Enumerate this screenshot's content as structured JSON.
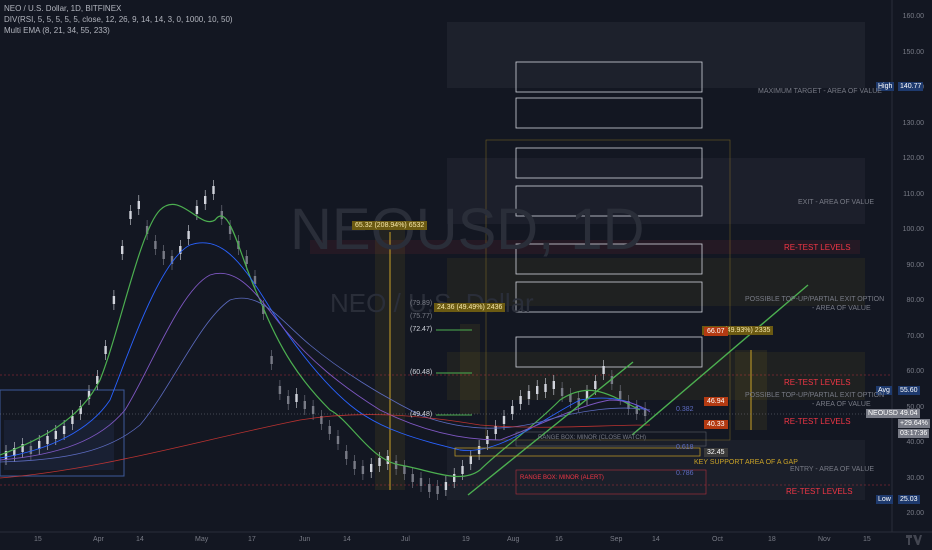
{
  "header": {
    "line1": "NEO / U.S. Dollar, 1D, BITFINEX",
    "line2": "DIV(RSI, 5, 5, 5, 5, 5, close, 12, 26, 9, 14, 14, 3, 0, 1000, 10, 50)",
    "line3": "Multi EMA (8, 21, 34, 55, 233)"
  },
  "watermark": {
    "symbol": "NEOUSD, 1D",
    "name": "NEO / U.S. Dollar"
  },
  "y_axis": {
    "ticks": [
      "160.00",
      "150.00",
      "140.00",
      "130.00",
      "120.00",
      "110.00",
      "100.00",
      "90.00",
      "80.00",
      "70.00",
      "60.00",
      "50.00",
      "40.00",
      "30.00",
      "20.00"
    ],
    "labels": {
      "high_label": "High",
      "high": "140.77",
      "avg_label": "Avg",
      "avg": "55.60",
      "sym": "NEOUSD",
      "price": "49.04",
      "change": "+29.64%",
      "countdown": "03:17:36",
      "low_label": "Low",
      "low": "25.03"
    }
  },
  "x_axis": {
    "ticks": [
      "15",
      "Apr",
      "14",
      "May",
      "17",
      "Jun",
      "14",
      "Jul",
      "19",
      "Aug",
      "16",
      "Sep",
      "14",
      "Oct",
      "18",
      "Nov",
      "15"
    ]
  },
  "annotations": {
    "max_target": "MAXIMUM TARGET - AREA OF VALUE",
    "exit": "EXIT - AREA OF VALUE",
    "retest1": "RE-TEST LEVELS",
    "partial1a": "POSSIBLE TOP-UP/PARTIAL EXIT OPTION",
    "partial1b": "- AREA OF VALUE",
    "retest2": "RE-TEST LEVELS",
    "partial2a": "POSSIBLE TOP-UP/PARTIAL EXIT OPTION",
    "partial2b": "- AREA OF VALUE",
    "retest3": "RE-TEST LEVELS",
    "entry": "ENTRY - AREA OF VALUE",
    "retest4": "RE-TEST LEVELS",
    "key_support": "KEY SUPPORT AREA OF A GAP",
    "range_close": "RANGE BOX: MINOR  (CLOSE WATCH)",
    "range_alert": "RANGE BOX: MINOR (ALERT)"
  },
  "measures": {
    "big": "65.32 (208.94%) 6532",
    "mid": "24.36 (49.49%) 2436",
    "right": "23.35 (49.93%) 2335"
  },
  "fib_levels": [
    "(79.89)",
    "(75.77)",
    "(72.47)",
    "(60.48)",
    "(49.48)"
  ],
  "price_tags": {
    "t1": "66.07",
    "t2": "46.94",
    "t3": "40.33",
    "t4": "32.45"
  },
  "fib_small": {
    "f1": "0.382",
    "f2": "0.618",
    "f3": "0.786"
  },
  "colors": {
    "bg": "#131722",
    "green": "#4caf50",
    "red": "#f23645",
    "gold": "#c9a227",
    "blue": "#3c5a99"
  }
}
